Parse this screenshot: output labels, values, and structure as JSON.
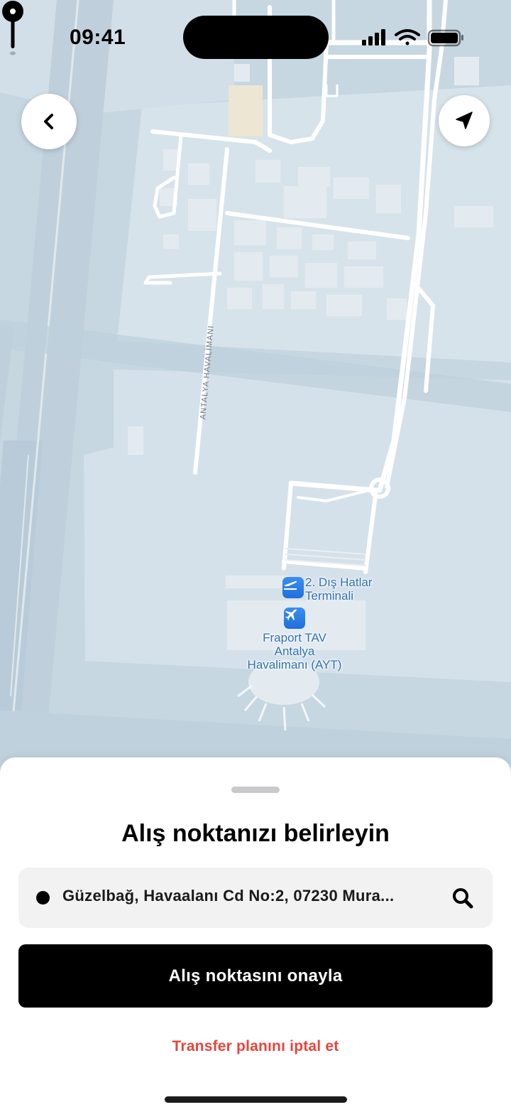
{
  "status_bar": {
    "time": "09:41"
  },
  "map": {
    "road_label": "ANTALYA HAVALİMANI",
    "poi_terminal": {
      "line1": "2. Dış Hatlar",
      "line2": "Terminali",
      "icon": "departures-icon"
    },
    "poi_airport": {
      "line1": "Fraport TAV",
      "line2": "Antalya",
      "line3": "Havalimanı (AYT)",
      "icon": "airplane-icon"
    }
  },
  "controls": {
    "back_icon": "chevron-left-icon",
    "locate_icon": "location-arrow-icon"
  },
  "sheet": {
    "title": "Alış noktanızı belirleyin",
    "address_value": "Güzelbağ, Havaalanı Cd No:2, 07230 Mura...",
    "confirm_label": "Alış noktasını onayla",
    "cancel_label": "Transfer planını iptal et"
  },
  "colors": {
    "accent_red": "#e8443a",
    "poi_blue": "#2f6fb5",
    "button_black": "#000000"
  }
}
